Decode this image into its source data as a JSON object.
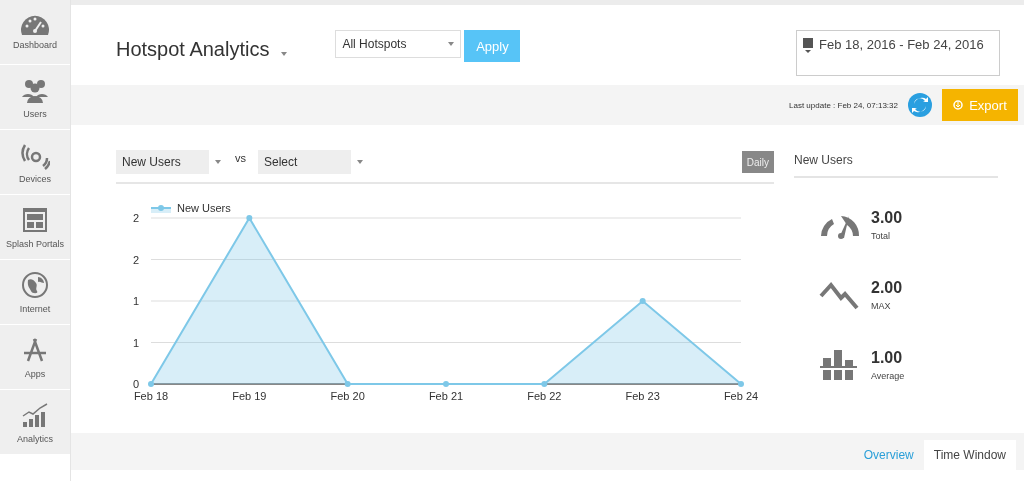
{
  "sidebar": {
    "items": [
      {
        "label": "Dashboard"
      },
      {
        "label": "Users"
      },
      {
        "label": "Devices"
      },
      {
        "label": "Splash Portals"
      },
      {
        "label": "Internet"
      },
      {
        "label": "Apps"
      },
      {
        "label": "Analytics"
      }
    ]
  },
  "header": {
    "title": "Hotspot Analytics",
    "hotspot_select": {
      "value": "All Hotspots"
    },
    "apply_button": "Apply",
    "date_range": "Feb 18, 2016 - Feb 24, 2016"
  },
  "toolbar": {
    "last_update": "Last update : Feb 24, 07:13:32",
    "export_button": "Export"
  },
  "chart_panel": {
    "metric_select": {
      "value": "New Users"
    },
    "vs_label": "vs",
    "compare_select": {
      "value": "Select"
    },
    "interval_button": "Daily",
    "chart_data": {
      "type": "area",
      "categories": [
        "Feb 18",
        "Feb 19",
        "Feb 20",
        "Feb 21",
        "Feb 22",
        "Feb 23",
        "Feb 24"
      ],
      "series": [
        {
          "name": "New Users",
          "color": "#7ec8e8",
          "values": [
            0,
            2,
            0,
            0,
            0,
            1,
            0
          ]
        }
      ],
      "ylim": [
        0,
        2
      ],
      "grid": true,
      "yticks": [
        {
          "value": 0,
          "label": "0"
        },
        {
          "value": 0.5,
          "label": "1"
        },
        {
          "value": 1,
          "label": "1"
        },
        {
          "value": 1.5,
          "label": "2"
        },
        {
          "value": 2,
          "label": "2"
        }
      ]
    }
  },
  "summary": {
    "title": "New Users",
    "stats": [
      {
        "value": "3.00",
        "label": "Total"
      },
      {
        "value": "2.00",
        "label": "MAX"
      },
      {
        "value": "1.00",
        "label": "Average"
      }
    ]
  },
  "bottom_tabs": [
    {
      "label": "Overview",
      "selected": false
    },
    {
      "label": "Time Window",
      "selected": true
    }
  ]
}
